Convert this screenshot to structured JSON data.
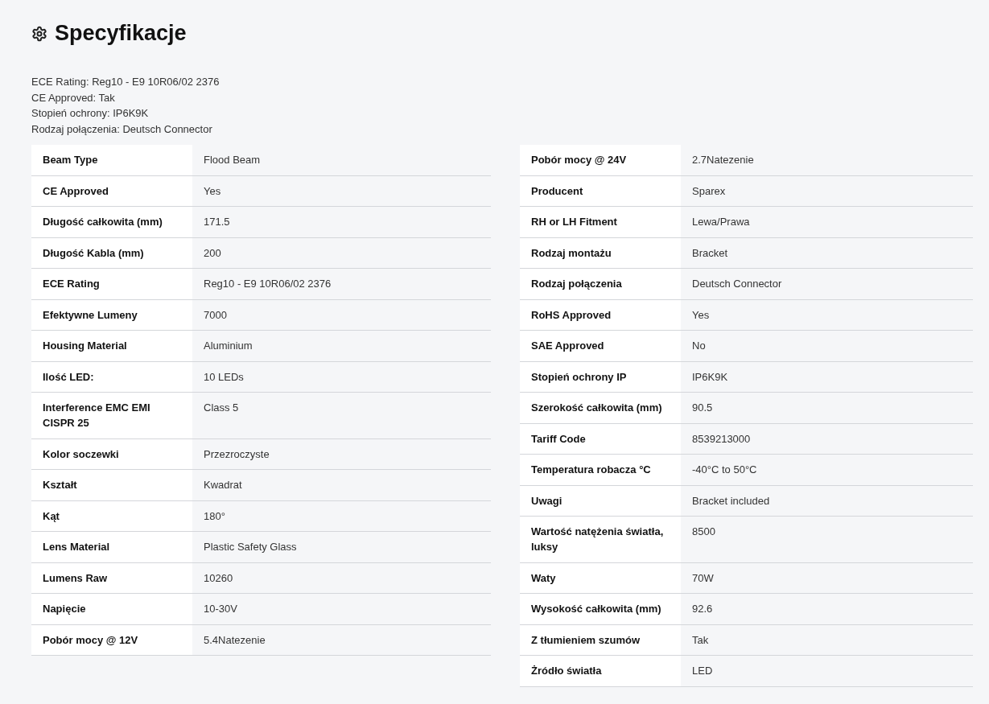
{
  "title": "Specyfikacje",
  "summary": [
    "ECE Rating: Reg10 - E9 10R06/02 2376",
    "CE Approved: Tak",
    "Stopień ochrony: IP6K9K",
    "Rodzaj połączenia: Deutsch Connector"
  ],
  "tables": [
    {
      "rows": [
        {
          "label": "Beam Type",
          "value": "Flood Beam"
        },
        {
          "label": "CE Approved",
          "value": "Yes"
        },
        {
          "label": "Długość całkowita (mm)",
          "value": "171.5"
        },
        {
          "label": "Długość Kabla (mm)",
          "value": "200"
        },
        {
          "label": "ECE Rating",
          "value": "Reg10 - E9 10R06/02 2376"
        },
        {
          "label": "Efektywne Lumeny",
          "value": "7000"
        },
        {
          "label": "Housing Material",
          "value": "Aluminium"
        },
        {
          "label": "Ilość LED:",
          "value": "10 LEDs"
        },
        {
          "label": "Interference EMC EMI CISPR 25",
          "value": "Class 5"
        },
        {
          "label": "Kolor soczewki",
          "value": "Przezroczyste"
        },
        {
          "label": "Kształt",
          "value": "Kwadrat"
        },
        {
          "label": "Kąt",
          "value": "180°"
        },
        {
          "label": "Lens Material",
          "value": "Plastic Safety Glass"
        },
        {
          "label": "Lumens Raw",
          "value": "10260"
        },
        {
          "label": "Napięcie",
          "value": "10-30V"
        },
        {
          "label": "Pobór mocy @ 12V",
          "value": "5.4Natezenie"
        }
      ]
    },
    {
      "rows": [
        {
          "label": "Pobór mocy @ 24V",
          "value": "2.7Natezenie"
        },
        {
          "label": "Producent",
          "value": "Sparex"
        },
        {
          "label": "RH or LH Fitment",
          "value": "Lewa/Prawa"
        },
        {
          "label": "Rodzaj montażu",
          "value": "Bracket"
        },
        {
          "label": "Rodzaj połączenia",
          "value": "Deutsch Connector"
        },
        {
          "label": "RoHS Approved",
          "value": "Yes"
        },
        {
          "label": "SAE Approved",
          "value": "No"
        },
        {
          "label": "Stopień ochrony IP",
          "value": "IP6K9K"
        },
        {
          "label": "Szerokość całkowita (mm)",
          "value": "90.5"
        },
        {
          "label": "Tariff Code",
          "value": "8539213000"
        },
        {
          "label": "Temperatura robacza °C",
          "value": "-40°C to 50°C"
        },
        {
          "label": "Uwagi",
          "value": "Bracket included"
        },
        {
          "label": "Wartość natężenia światła, luksy",
          "value": "8500"
        },
        {
          "label": "Waty",
          "value": "70W"
        },
        {
          "label": "Wysokość całkowita (mm)",
          "value": "92.6"
        },
        {
          "label": "Z tłumieniem szumów",
          "value": "Tak"
        },
        {
          "label": "Żródło światła",
          "value": "LED"
        }
      ]
    }
  ]
}
